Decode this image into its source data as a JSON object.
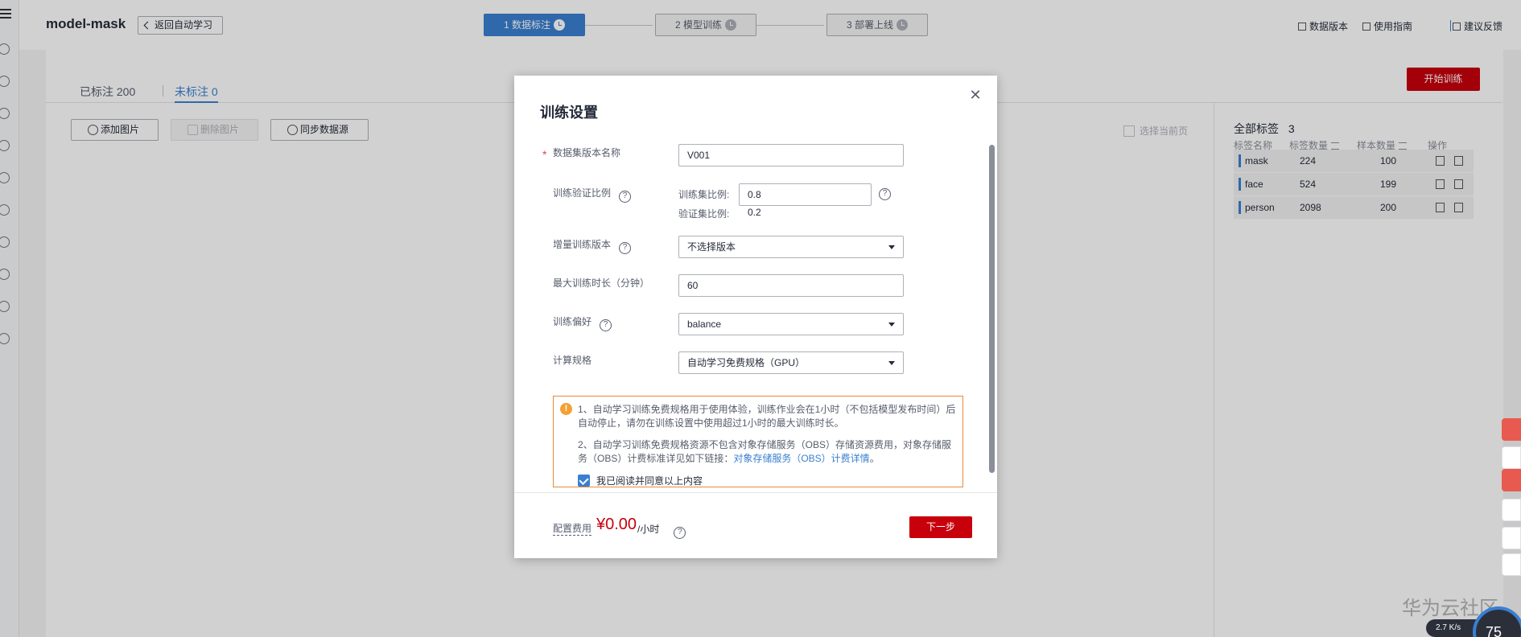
{
  "header": {
    "app_title": "model-mask",
    "back_label": "返回自动学习",
    "steps": [
      {
        "label": "1 数据标注",
        "active": true
      },
      {
        "label": "2 模型训练",
        "active": false
      },
      {
        "label": "3 部署上线",
        "active": false
      }
    ],
    "links": {
      "data_version": "数据版本",
      "guide": "使用指南",
      "feedback": "建议反馈"
    }
  },
  "page": {
    "tabs": [
      {
        "label": "已标注 200",
        "active": false
      },
      {
        "label": "未标注 0",
        "active": true
      }
    ],
    "start_training_label": "开始训练",
    "toolbar": {
      "add_image": "添加图片",
      "delete_image": "删除图片",
      "sync_source": "同步数据源"
    },
    "select_current_page": "选择当前页",
    "labels_panel": {
      "title": "全部标签",
      "count": "3",
      "columns": {
        "name": "标签名称",
        "label_count": "标签数量",
        "sample_count": "样本数量",
        "actions": "操作"
      },
      "rows": [
        {
          "name": "mask",
          "label_count": "224",
          "sample_count": "100"
        },
        {
          "name": "face",
          "label_count": "524",
          "sample_count": "199"
        },
        {
          "name": "person",
          "label_count": "2098",
          "sample_count": "200"
        }
      ]
    }
  },
  "modal": {
    "title": "训练设置",
    "close_icon": "close-icon",
    "fields": {
      "dataset_version": {
        "label": "数据集版本名称",
        "value": "V001"
      },
      "split_ratio": {
        "label": "训练验证比例",
        "train_label": "训练集比例:",
        "train_value": "0.8",
        "val_label": "验证集比例:",
        "val_value": "0.2"
      },
      "incremental": {
        "label": "增量训练版本",
        "value": "不选择版本"
      },
      "max_duration": {
        "label": "最大训练时长（分钟）",
        "value": "60"
      },
      "preference": {
        "label": "训练偏好",
        "value": "balance"
      },
      "compute_spec": {
        "label": "计算规格",
        "value": "自动学习免费规格（GPU）"
      }
    },
    "notice": {
      "line1": "1、自动学习训练免费规格用于使用体验，训练作业会在1小时（不包括模型发布时间）后自动停止，请勿在训练设置中使用超过1小时的最大训练时长。",
      "line2_prefix": "2、自动学习训练免费规格资源不包含对象存储服务（OBS）存储资源费用，对象存储服务（OBS）计费标准详见如下链接：",
      "line2_link": "对象存储服务（OBS）计费详情",
      "line2_suffix": "。",
      "agree": "我已阅读并同意以上内容"
    },
    "footer": {
      "cost_label": "配置费用",
      "cost_value": "¥0.00",
      "cost_unit": "/小时",
      "next_label": "下一步"
    }
  },
  "watermark": "华为云社区",
  "status": {
    "speed": "2.7 K/s",
    "gauge": "75"
  },
  "colors": {
    "brand_red": "#c7000b",
    "accent_blue": "#3a7fd1",
    "warning_orange": "#ea8a3a"
  }
}
